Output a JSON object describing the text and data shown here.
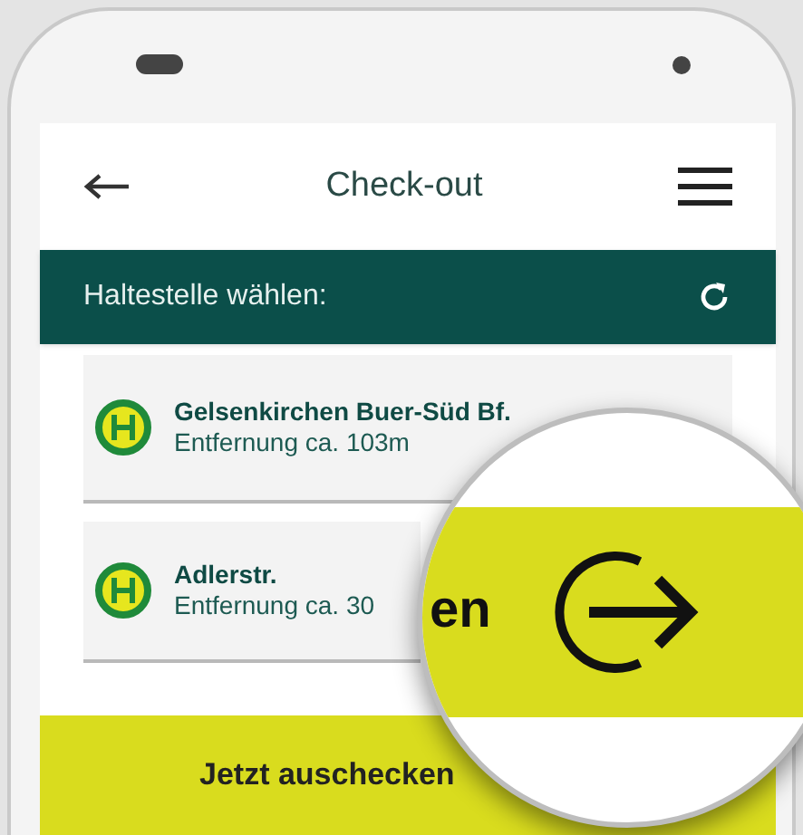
{
  "header": {
    "title": "Check-out"
  },
  "section": {
    "title": "Haltestelle wählen:"
  },
  "stops": [
    {
      "name": "Gelsenkirchen Buer-Süd Bf.",
      "distance": "Entfernung ca. 103m"
    },
    {
      "name": "Adlerstr.",
      "distance": "Entfernung ca. 30"
    }
  ],
  "button": {
    "label": "Jetzt auschecken"
  },
  "magnifier": {
    "text": "en"
  }
}
